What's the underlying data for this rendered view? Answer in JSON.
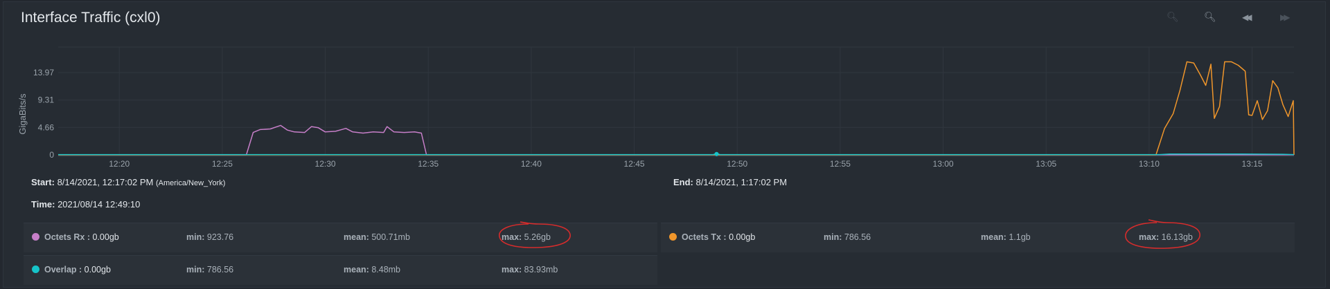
{
  "panel": {
    "title": "Interface Traffic (cxl0)",
    "toolbar": [
      {
        "icon": "zoom-out-icon",
        "glyph": "🔍︎",
        "dim": true
      },
      {
        "icon": "zoom-in-icon",
        "glyph": "🔍︎",
        "dim": false
      },
      {
        "icon": "rewind-icon",
        "glyph": "◀◀",
        "dim": false
      },
      {
        "icon": "fast-forward-icon",
        "glyph": "▶▶",
        "dim": true
      }
    ]
  },
  "info": {
    "start_label": "Start:",
    "start_value": "8/14/2021, 12:17:02 PM",
    "start_tz": "(America/New_York)",
    "end_label": "End:",
    "end_value": "8/14/2021, 1:17:02 PM",
    "time_label": "Time:",
    "time_value": "2021/08/14 12:49:10"
  },
  "stats": [
    {
      "name": "Octets Rx :",
      "current": "0.00gb",
      "min_label": "min:",
      "min": "923.76",
      "mean_label": "mean:",
      "mean": "500.71mb",
      "max_label": "max:",
      "max": "5.26gb",
      "color": "#c77fc9",
      "circled": true
    },
    {
      "name": "Octets Tx :",
      "current": "0.00gb",
      "min_label": "min:",
      "min": "786.56",
      "mean_label": "mean:",
      "mean": "1.1gb",
      "max_label": "max:",
      "max": "16.13gb",
      "color": "#f0962b",
      "circled": true
    },
    {
      "name": "Overlap :",
      "current": "0.00gb",
      "min_label": "min:",
      "min": "786.56",
      "mean_label": "mean:",
      "mean": "8.48mb",
      "max_label": "max:",
      "max": "83.93mb",
      "color": "#16c4c9",
      "circled": false
    }
  ],
  "chart_data": {
    "type": "line",
    "ylabel": "GigaBits/s",
    "ylim": [
      0,
      16.13
    ],
    "yticks": [
      0,
      4.66,
      9.31,
      13.97
    ],
    "xlim": [
      "12:17:02",
      "13:17:02"
    ],
    "xticks": [
      "12:20",
      "12:25",
      "12:30",
      "12:35",
      "12:40",
      "12:45",
      "12:50",
      "12:55",
      "13:00",
      "13:05",
      "13:10",
      "13:15"
    ],
    "grid": true,
    "series": [
      {
        "name": "Octets Rx",
        "color": "#c77fc9",
        "points": [
          [
            "12:17:02",
            0
          ],
          [
            "12:26:10",
            0
          ],
          [
            "12:26:30",
            3.8
          ],
          [
            "12:26:50",
            4.3
          ],
          [
            "12:27:20",
            4.4
          ],
          [
            "12:27:50",
            5.0
          ],
          [
            "12:28:10",
            4.2
          ],
          [
            "12:28:30",
            3.9
          ],
          [
            "12:29:00",
            3.8
          ],
          [
            "12:29:20",
            4.8
          ],
          [
            "12:29:40",
            4.6
          ],
          [
            "12:30:00",
            3.9
          ],
          [
            "12:30:30",
            4.0
          ],
          [
            "12:31:00",
            4.5
          ],
          [
            "12:31:20",
            3.9
          ],
          [
            "12:31:50",
            3.7
          ],
          [
            "12:32:20",
            3.9
          ],
          [
            "12:32:50",
            3.8
          ],
          [
            "12:33:00",
            4.8
          ],
          [
            "12:33:20",
            3.9
          ],
          [
            "12:33:50",
            3.8
          ],
          [
            "12:34:20",
            3.9
          ],
          [
            "12:34:40",
            3.7
          ],
          [
            "12:34:55",
            0
          ],
          [
            "13:17:02",
            0
          ]
        ]
      },
      {
        "name": "Octets Tx",
        "color": "#f0962b",
        "points": [
          [
            "12:17:02",
            0
          ],
          [
            "13:10:20",
            0
          ],
          [
            "13:10:45",
            4.5
          ],
          [
            "13:11:10",
            7.0
          ],
          [
            "13:11:30",
            11.0
          ],
          [
            "13:11:50",
            15.8
          ],
          [
            "13:12:10",
            15.6
          ],
          [
            "13:12:30",
            13.5
          ],
          [
            "13:12:45",
            11.8
          ],
          [
            "13:13:00",
            15.4
          ],
          [
            "13:13:10",
            6.2
          ],
          [
            "13:13:25",
            8.2
          ],
          [
            "13:13:40",
            15.8
          ],
          [
            "13:14:00",
            15.8
          ],
          [
            "13:14:20",
            15.2
          ],
          [
            "13:14:40",
            14.2
          ],
          [
            "13:14:50",
            6.8
          ],
          [
            "13:15:00",
            6.7
          ],
          [
            "13:15:15",
            9.2
          ],
          [
            "13:15:30",
            6.0
          ],
          [
            "13:15:45",
            7.5
          ],
          [
            "13:16:00",
            12.6
          ],
          [
            "13:16:15",
            11.4
          ],
          [
            "13:16:30",
            8.5
          ],
          [
            "13:16:45",
            6.5
          ],
          [
            "13:17:00",
            9.2
          ],
          [
            "13:17:02",
            0
          ]
        ]
      },
      {
        "name": "Overlap",
        "color": "#16c4c9",
        "points": [
          [
            "12:17:02",
            0.05
          ],
          [
            "12:48:50",
            0.05
          ],
          [
            "12:49:00",
            0.25
          ],
          [
            "12:49:10",
            0.05
          ],
          [
            "13:10:30",
            0.05
          ],
          [
            "13:11:00",
            0.15
          ],
          [
            "13:14:30",
            0.15
          ],
          [
            "13:16:30",
            0.1
          ],
          [
            "13:17:02",
            0.05
          ]
        ]
      }
    ]
  }
}
